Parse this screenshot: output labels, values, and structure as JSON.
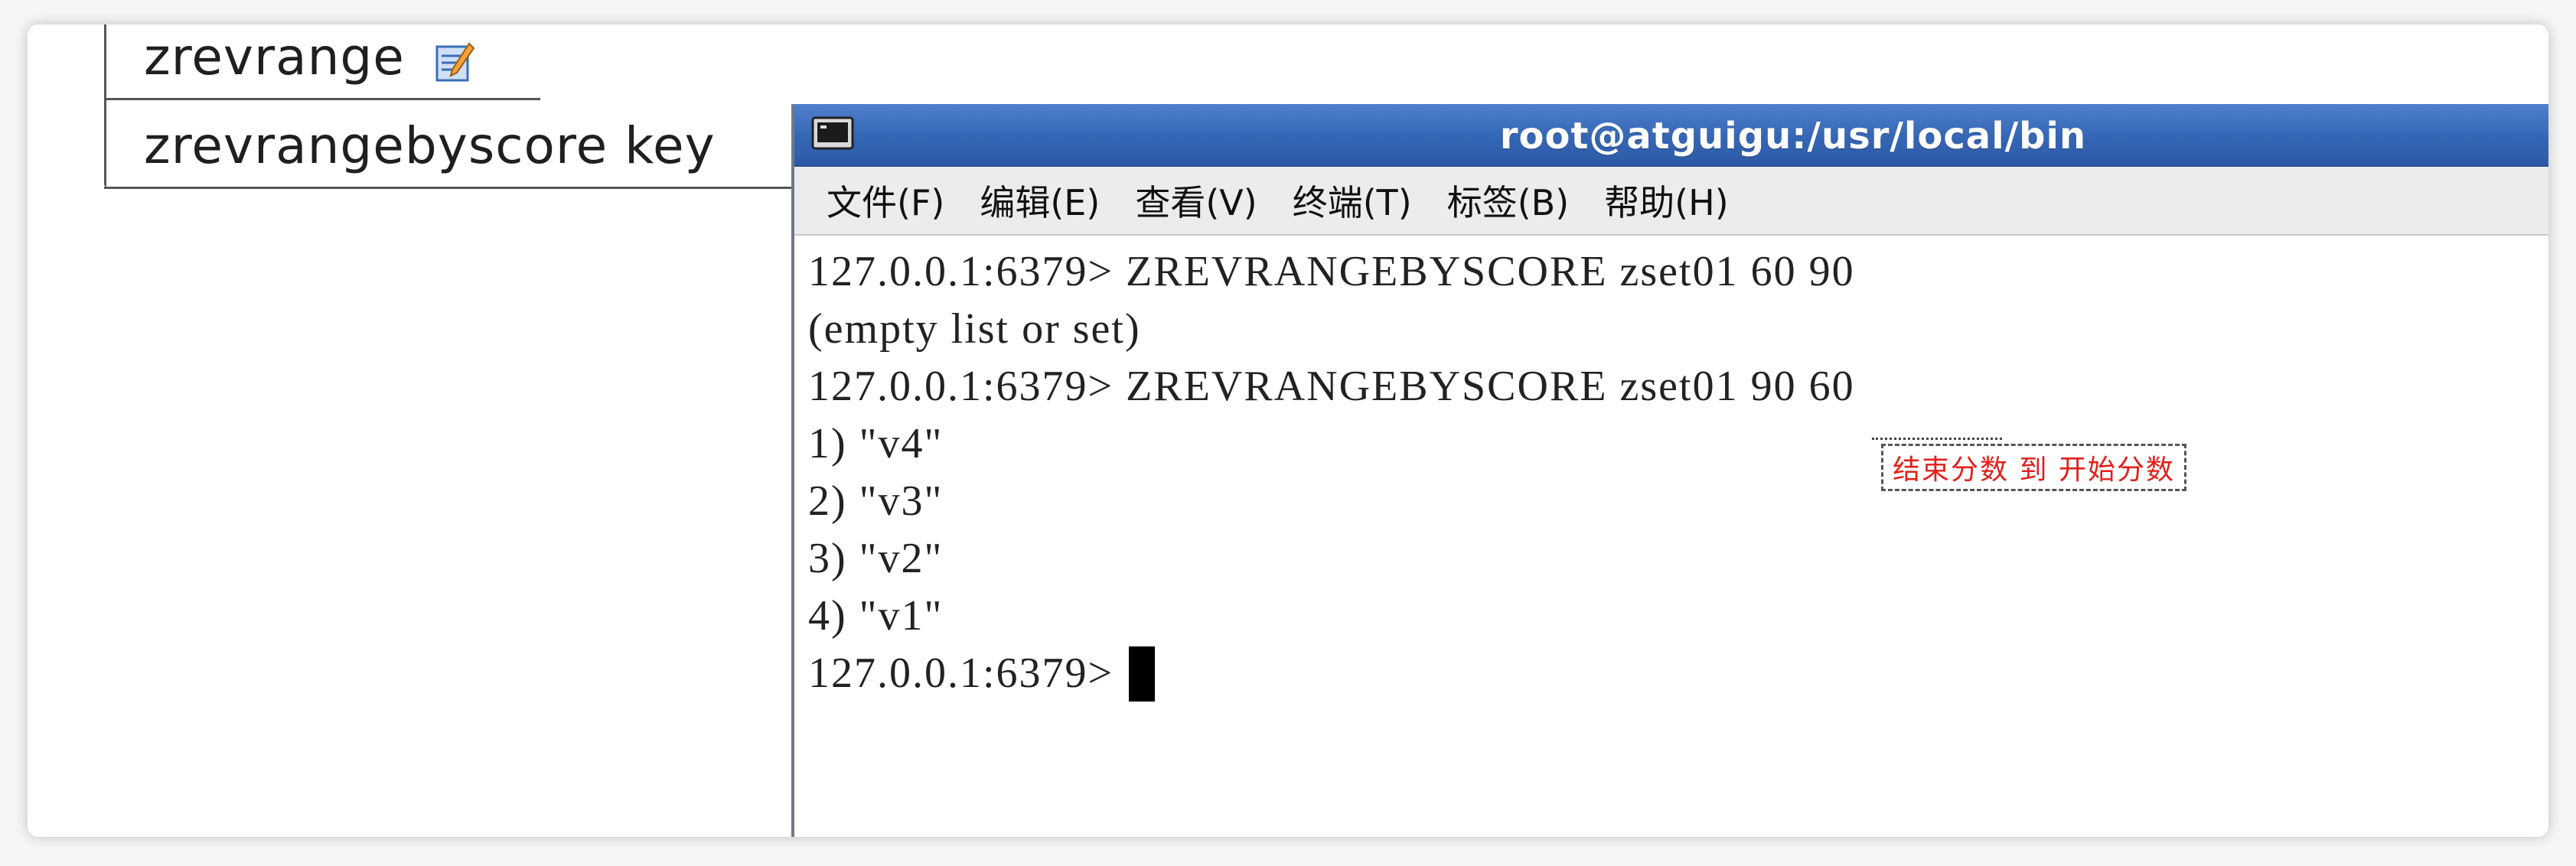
{
  "notes": {
    "row1_command": "zrevrange",
    "row2_command": "zrevrangebyscore  key",
    "icon": "edit-note-icon"
  },
  "terminal": {
    "title": "root@atguigu:/usr/local/bin",
    "menu": [
      "文件(F)",
      "编辑(E)",
      "查看(V)",
      "终端(T)",
      "标签(B)",
      "帮助(H)"
    ],
    "lines": [
      "127.0.0.1:6379> ZREVRANGEBYSCORE zset01 60 90",
      "(empty list or set)",
      "127.0.0.1:6379> ZREVRANGEBYSCORE zset01 90 60",
      "1) \"v4\"",
      "2) \"v3\"",
      "3) \"v2\"",
      "4) \"v1\""
    ],
    "prompt": "127.0.0.1:6379> ",
    "annotation": "结束分数 到 开始分数"
  },
  "colors": {
    "titlebar": "#3566b5",
    "annotation_text": "#e0201a"
  }
}
